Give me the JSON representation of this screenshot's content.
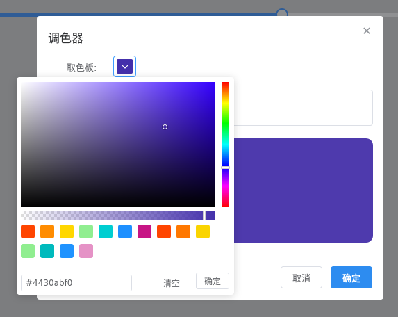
{
  "dialog": {
    "title": "调色器",
    "field_label": "取色板:",
    "cancel_label": "取消",
    "ok_label": "确定"
  },
  "picker": {
    "current_color": "#4430ab",
    "hex_value": "#4430abf0",
    "clear_label": "清空",
    "confirm_label": "确定",
    "predefine_colors": [
      "#ff4500",
      "#ff8c00",
      "#ffd700",
      "#90ee90",
      "#00ced1",
      "#1e90ff",
      "#c71585",
      "#ff4500",
      "#ff7800",
      "#fad400",
      "#90ee90",
      "#00babd",
      "#1f93ff",
      "#c7158577"
    ]
  },
  "icons": {
    "close": "close-icon",
    "trigger_arrow": "chevron-down-icon"
  }
}
